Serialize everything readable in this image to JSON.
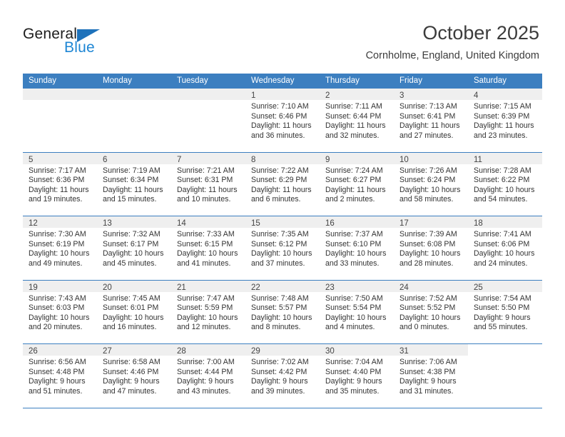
{
  "brand": {
    "name_primary": "General",
    "name_secondary": "Blue",
    "logo_icon": "triangle-flag-icon"
  },
  "header": {
    "title": "October 2025",
    "location": "Cornholme, England, United Kingdom"
  },
  "calendar": {
    "weekday_headers": [
      "Sunday",
      "Monday",
      "Tuesday",
      "Wednesday",
      "Thursday",
      "Friday",
      "Saturday"
    ],
    "accent_color": "#3c7fc0",
    "daynum_strip_color": "#efefef",
    "weeks": [
      [
        {
          "day": "",
          "lines": []
        },
        {
          "day": "",
          "lines": []
        },
        {
          "day": "",
          "lines": []
        },
        {
          "day": "1",
          "lines": [
            "Sunrise: 7:10 AM",
            "Sunset: 6:46 PM",
            "Daylight: 11 hours",
            "and 36 minutes."
          ]
        },
        {
          "day": "2",
          "lines": [
            "Sunrise: 7:11 AM",
            "Sunset: 6:44 PM",
            "Daylight: 11 hours",
            "and 32 minutes."
          ]
        },
        {
          "day": "3",
          "lines": [
            "Sunrise: 7:13 AM",
            "Sunset: 6:41 PM",
            "Daylight: 11 hours",
            "and 27 minutes."
          ]
        },
        {
          "day": "4",
          "lines": [
            "Sunrise: 7:15 AM",
            "Sunset: 6:39 PM",
            "Daylight: 11 hours",
            "and 23 minutes."
          ]
        }
      ],
      [
        {
          "day": "5",
          "lines": [
            "Sunrise: 7:17 AM",
            "Sunset: 6:36 PM",
            "Daylight: 11 hours",
            "and 19 minutes."
          ]
        },
        {
          "day": "6",
          "lines": [
            "Sunrise: 7:19 AM",
            "Sunset: 6:34 PM",
            "Daylight: 11 hours",
            "and 15 minutes."
          ]
        },
        {
          "day": "7",
          "lines": [
            "Sunrise: 7:21 AM",
            "Sunset: 6:31 PM",
            "Daylight: 11 hours",
            "and 10 minutes."
          ]
        },
        {
          "day": "8",
          "lines": [
            "Sunrise: 7:22 AM",
            "Sunset: 6:29 PM",
            "Daylight: 11 hours",
            "and 6 minutes."
          ]
        },
        {
          "day": "9",
          "lines": [
            "Sunrise: 7:24 AM",
            "Sunset: 6:27 PM",
            "Daylight: 11 hours",
            "and 2 minutes."
          ]
        },
        {
          "day": "10",
          "lines": [
            "Sunrise: 7:26 AM",
            "Sunset: 6:24 PM",
            "Daylight: 10 hours",
            "and 58 minutes."
          ]
        },
        {
          "day": "11",
          "lines": [
            "Sunrise: 7:28 AM",
            "Sunset: 6:22 PM",
            "Daylight: 10 hours",
            "and 54 minutes."
          ]
        }
      ],
      [
        {
          "day": "12",
          "lines": [
            "Sunrise: 7:30 AM",
            "Sunset: 6:19 PM",
            "Daylight: 10 hours",
            "and 49 minutes."
          ]
        },
        {
          "day": "13",
          "lines": [
            "Sunrise: 7:32 AM",
            "Sunset: 6:17 PM",
            "Daylight: 10 hours",
            "and 45 minutes."
          ]
        },
        {
          "day": "14",
          "lines": [
            "Sunrise: 7:33 AM",
            "Sunset: 6:15 PM",
            "Daylight: 10 hours",
            "and 41 minutes."
          ]
        },
        {
          "day": "15",
          "lines": [
            "Sunrise: 7:35 AM",
            "Sunset: 6:12 PM",
            "Daylight: 10 hours",
            "and 37 minutes."
          ]
        },
        {
          "day": "16",
          "lines": [
            "Sunrise: 7:37 AM",
            "Sunset: 6:10 PM",
            "Daylight: 10 hours",
            "and 33 minutes."
          ]
        },
        {
          "day": "17",
          "lines": [
            "Sunrise: 7:39 AM",
            "Sunset: 6:08 PM",
            "Daylight: 10 hours",
            "and 28 minutes."
          ]
        },
        {
          "day": "18",
          "lines": [
            "Sunrise: 7:41 AM",
            "Sunset: 6:06 PM",
            "Daylight: 10 hours",
            "and 24 minutes."
          ]
        }
      ],
      [
        {
          "day": "19",
          "lines": [
            "Sunrise: 7:43 AM",
            "Sunset: 6:03 PM",
            "Daylight: 10 hours",
            "and 20 minutes."
          ]
        },
        {
          "day": "20",
          "lines": [
            "Sunrise: 7:45 AM",
            "Sunset: 6:01 PM",
            "Daylight: 10 hours",
            "and 16 minutes."
          ]
        },
        {
          "day": "21",
          "lines": [
            "Sunrise: 7:47 AM",
            "Sunset: 5:59 PM",
            "Daylight: 10 hours",
            "and 12 minutes."
          ]
        },
        {
          "day": "22",
          "lines": [
            "Sunrise: 7:48 AM",
            "Sunset: 5:57 PM",
            "Daylight: 10 hours",
            "and 8 minutes."
          ]
        },
        {
          "day": "23",
          "lines": [
            "Sunrise: 7:50 AM",
            "Sunset: 5:54 PM",
            "Daylight: 10 hours",
            "and 4 minutes."
          ]
        },
        {
          "day": "24",
          "lines": [
            "Sunrise: 7:52 AM",
            "Sunset: 5:52 PM",
            "Daylight: 10 hours",
            "and 0 minutes."
          ]
        },
        {
          "day": "25",
          "lines": [
            "Sunrise: 7:54 AM",
            "Sunset: 5:50 PM",
            "Daylight: 9 hours",
            "and 55 minutes."
          ]
        }
      ],
      [
        {
          "day": "26",
          "lines": [
            "Sunrise: 6:56 AM",
            "Sunset: 4:48 PM",
            "Daylight: 9 hours",
            "and 51 minutes."
          ]
        },
        {
          "day": "27",
          "lines": [
            "Sunrise: 6:58 AM",
            "Sunset: 4:46 PM",
            "Daylight: 9 hours",
            "and 47 minutes."
          ]
        },
        {
          "day": "28",
          "lines": [
            "Sunrise: 7:00 AM",
            "Sunset: 4:44 PM",
            "Daylight: 9 hours",
            "and 43 minutes."
          ]
        },
        {
          "day": "29",
          "lines": [
            "Sunrise: 7:02 AM",
            "Sunset: 4:42 PM",
            "Daylight: 9 hours",
            "and 39 minutes."
          ]
        },
        {
          "day": "30",
          "lines": [
            "Sunrise: 7:04 AM",
            "Sunset: 4:40 PM",
            "Daylight: 9 hours",
            "and 35 minutes."
          ]
        },
        {
          "day": "31",
          "lines": [
            "Sunrise: 7:06 AM",
            "Sunset: 4:38 PM",
            "Daylight: 9 hours",
            "and 31 minutes."
          ]
        },
        {
          "day": "",
          "lines": []
        }
      ]
    ]
  }
}
